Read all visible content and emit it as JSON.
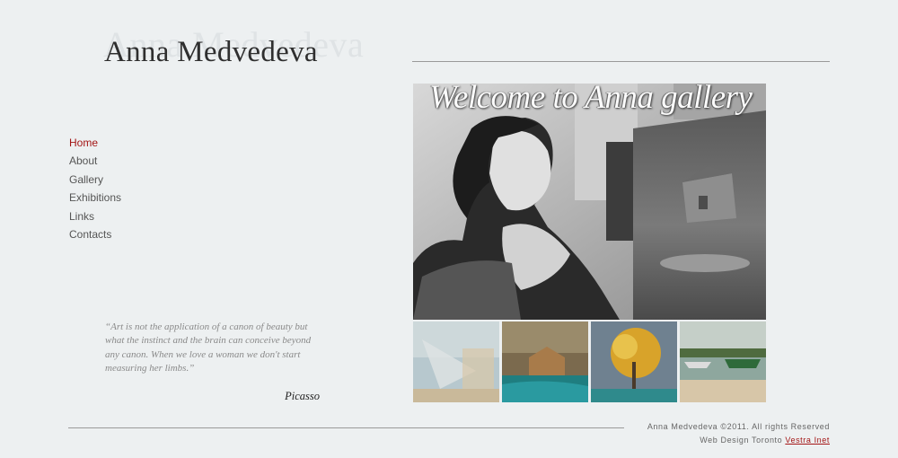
{
  "site": {
    "title": "Anna Medvedeva",
    "title_shadow": "Anna Medvedeva"
  },
  "nav": {
    "items": [
      {
        "label": "Home",
        "active": true
      },
      {
        "label": "About"
      },
      {
        "label": "Gallery"
      },
      {
        "label": "Exhibitions"
      },
      {
        "label": "Links"
      },
      {
        "label": "Contacts"
      }
    ]
  },
  "hero": {
    "caption": "Welcome to Anna gallery"
  },
  "thumbnails": [
    {
      "name": "painting-abstract-blue"
    },
    {
      "name": "painting-house-sea"
    },
    {
      "name": "painting-autumn-tree"
    },
    {
      "name": "painting-boats-harbor"
    }
  ],
  "quote": {
    "text": "“Art is not the application of a canon of beauty but what the instinct and the brain can conceive beyond any canon. When we love a woman we don't start measuring her limbs.”",
    "author": "Picasso"
  },
  "footer": {
    "copyright": "Anna Medvedeva ©2011. All rights Reserved",
    "credit_prefix": "Web Design Toronto",
    "credit_link": "Vestra Inet"
  },
  "colors": {
    "background": "#edf0f1",
    "accent": "#a31515",
    "text": "#555555"
  }
}
